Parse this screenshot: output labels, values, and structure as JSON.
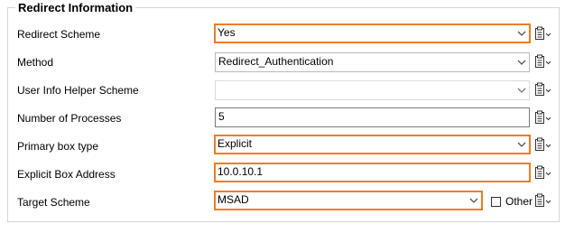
{
  "group": {
    "title": "Redirect Information"
  },
  "rows": [
    {
      "label": "Redirect Scheme",
      "value": "Yes",
      "type": "select",
      "highlighted": true
    },
    {
      "label": "Method",
      "value": "Redirect_Authentication",
      "type": "select",
      "highlighted": false
    },
    {
      "label": "User Info Helper Scheme",
      "value": "",
      "type": "select",
      "highlighted": false
    },
    {
      "label": "Number of Processes",
      "value": "5",
      "type": "text",
      "highlighted": false
    },
    {
      "label": "Primary box type",
      "value": "Explicit",
      "type": "select",
      "highlighted": true
    },
    {
      "label": "Explicit Box Address",
      "value": "10.0.10.1",
      "type": "text",
      "highlighted": true
    },
    {
      "label": "Target Scheme",
      "value": "MSAD",
      "type": "select",
      "highlighted": true
    }
  ],
  "other_checkbox": {
    "label": "Other",
    "checked": false
  },
  "icons": {
    "dropdown": "chevron-down-icon",
    "picker": "clipboard-menu-icon"
  },
  "colors": {
    "highlight": "#ee7d22",
    "border": "#b9b9b9"
  }
}
